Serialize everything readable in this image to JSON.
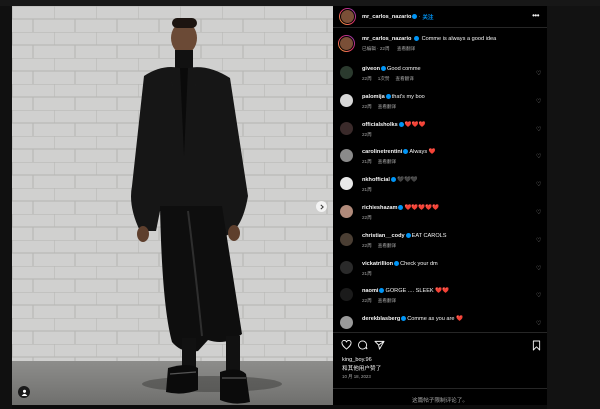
{
  "post": {
    "author": "mr_carlos_nazario",
    "follow_label": "关注",
    "caption": "Comme is always a good idea",
    "caption_meta": [
      "已编辑 · 22周",
      "查看翻译"
    ]
  },
  "comments": [
    {
      "user": "giveon",
      "text": "Good comme",
      "meta": [
        "22周",
        "1次赞",
        "查看翻译"
      ],
      "avatar_color": "#2b3a2e"
    },
    {
      "user": "palomija",
      "text": "that's my boo",
      "meta": [
        "22周",
        "查看翻译"
      ],
      "avatar_color": "#d7d7d7"
    },
    {
      "user": "officialsholks",
      "text": "❤️❤️❤️",
      "meta": [
        "22周"
      ],
      "avatar_color": "#3a2a2a"
    },
    {
      "user": "carolinetrentini",
      "text": "Always ❤️",
      "meta": [
        "21周",
        "查看翻译"
      ],
      "avatar_color": "#8a8a8a"
    },
    {
      "user": "nkhofficial",
      "text": "🖤🖤🖤",
      "meta": [
        "21周"
      ],
      "avatar_color": "#e8e8e8"
    },
    {
      "user": "richieshazam",
      "text": "❤️❤️❤️❤️❤️",
      "meta": [
        "22周"
      ],
      "avatar_color": "#b08a7a"
    },
    {
      "user": "christian__cody",
      "text": "EAT CAROLS",
      "meta": [
        "22周",
        "查看翻译"
      ],
      "avatar_color": "#4a3e33"
    },
    {
      "user": "vickatrillion",
      "text": "Check your dm",
      "meta": [
        "21周"
      ],
      "avatar_color": "#2a2a2a"
    },
    {
      "user": "naomi",
      "text": "GORGE .... SLEEK ❤️❤️",
      "meta": [
        "22周",
        "查看翻译"
      ],
      "avatar_color": "#1b1b1b"
    },
    {
      "user": "derekblasberg",
      "text": "Comme as you are ❤️",
      "meta": [],
      "avatar_color": "#9a9a9a"
    }
  ],
  "footer": {
    "liked_by_user": "king_boy.96",
    "liked_by_suffix": "和其他用户赞了",
    "date": "10 月 18, 2023",
    "comments_limited": "这篇帖子限制评论了。"
  },
  "icons": [
    "more-icon",
    "heart-icon",
    "comment-icon",
    "share-icon",
    "bookmark-icon",
    "user-tag-icon",
    "chevron-right-icon",
    "verified-icon"
  ],
  "colors": {
    "accent": "#0095f6",
    "background": "#000000",
    "muted": "#a8a8a8",
    "like": "#ed4956"
  }
}
